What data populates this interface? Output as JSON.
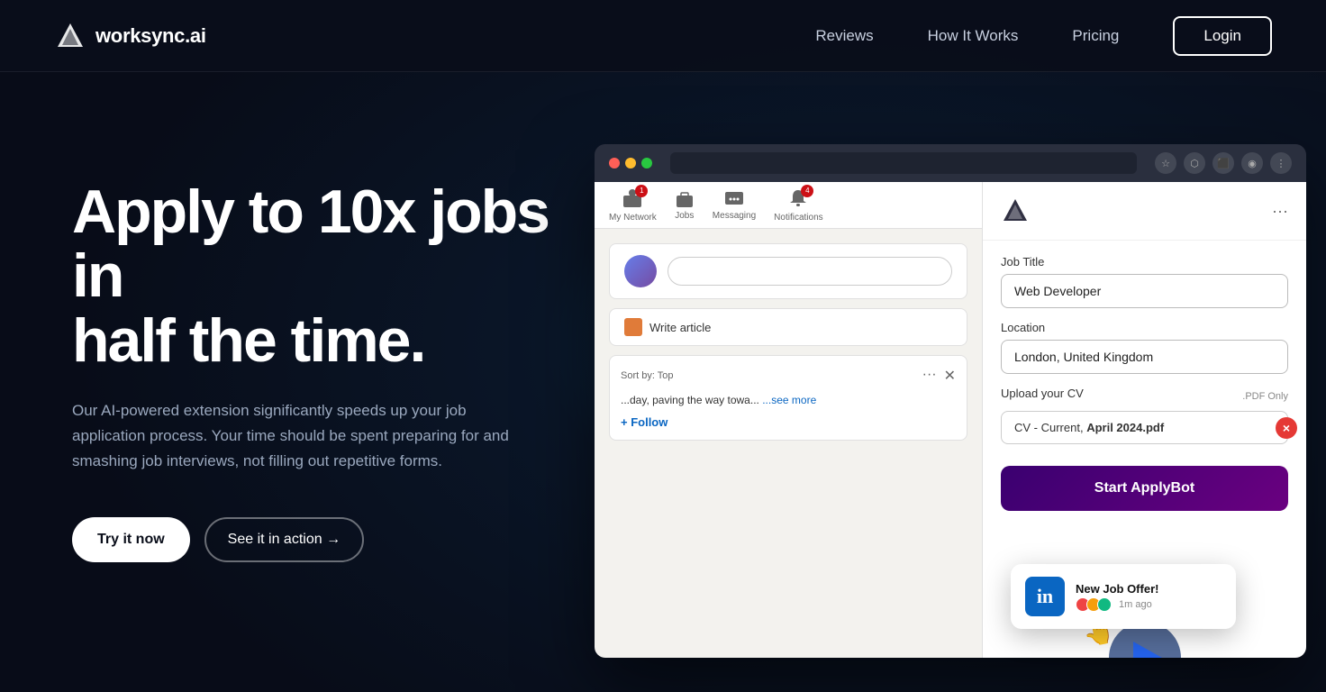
{
  "meta": {
    "page_title": "worksync.ai - Apply to 10x jobs in half the time"
  },
  "navbar": {
    "logo_text": "worksync.ai",
    "nav_links": [
      {
        "id": "reviews",
        "label": "Reviews"
      },
      {
        "id": "how-it-works",
        "label": "How It Works"
      },
      {
        "id": "pricing",
        "label": "Pricing"
      }
    ],
    "login_label": "Login"
  },
  "hero": {
    "heading_line1": "Apply to 10x jobs in",
    "heading_line2": "half the time.",
    "subtext": "Our AI-powered extension significantly speeds up your job application process. Your time should be spent preparing for and smashing job interviews, not filling out repetitive forms.",
    "btn_primary": "Try it now",
    "btn_secondary": "See it in action →"
  },
  "browser_mockup": {
    "extension": {
      "job_title_label": "Job Title",
      "job_title_value": "Web Developer",
      "location_label": "Location",
      "location_value": "London, United Kingdom",
      "upload_label": "Upload your CV",
      "upload_pdf_note": ".PDF Only",
      "upload_file_value": "CV - Current, April 2024.pdf",
      "apply_btn_label": "Start ApplyBot",
      "menu_dots": "···"
    },
    "linkedin": {
      "nav_items": [
        {
          "label": "My Network",
          "badge": "1"
        },
        {
          "label": "Jobs",
          "badge": ""
        },
        {
          "label": "Messaging",
          "badge": ""
        },
        {
          "label": "Notifications",
          "badge": "4"
        }
      ],
      "write_article_label": "Write article",
      "sort_label": "Sort by: Top",
      "feed_text": "...day, paving the way towa...",
      "see_more": "...see more",
      "follow_label": "+ Follow"
    },
    "notification": {
      "title": "New Job Offer!",
      "time": "1m ago"
    }
  }
}
